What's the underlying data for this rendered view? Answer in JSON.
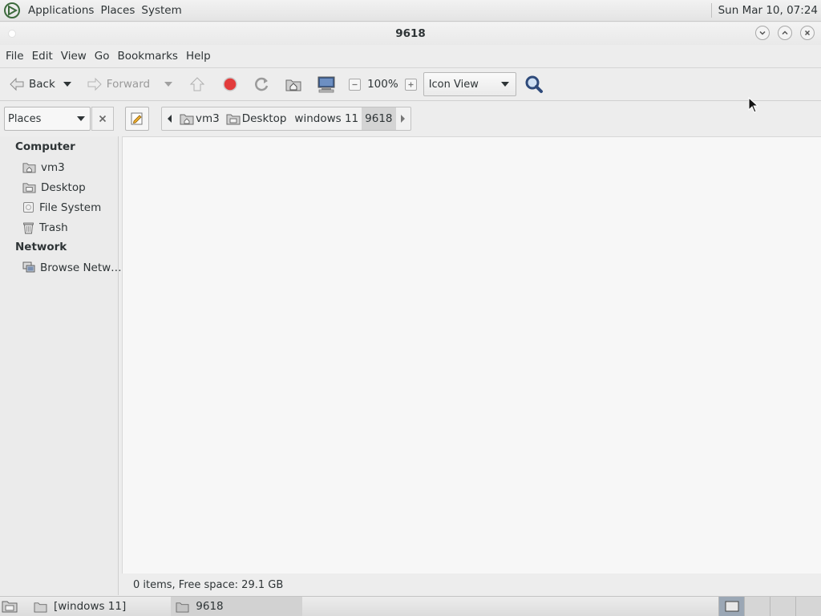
{
  "top_panel": {
    "menus": [
      "Applications",
      "Places",
      "System"
    ],
    "clock": "Sun Mar 10, 07:24"
  },
  "window": {
    "title": "9618"
  },
  "menubar": [
    "File",
    "Edit",
    "View",
    "Go",
    "Bookmarks",
    "Help"
  ],
  "toolbar": {
    "back_label": "Back",
    "forward_label": "Forward",
    "zoom_level": "100%",
    "view_mode": "Icon View"
  },
  "location": {
    "side_pane_mode": "Places",
    "breadcrumbs": [
      "vm3",
      "Desktop",
      "windows 11",
      "9618"
    ]
  },
  "sidebar": {
    "sections": [
      {
        "header": "Computer",
        "items": [
          "vm3",
          "Desktop",
          "File System",
          "Trash"
        ]
      },
      {
        "header": "Network",
        "items": [
          "Browse Netw…"
        ]
      }
    ]
  },
  "status": "0 items, Free space: 29.1 GB",
  "taskbar": {
    "tasks": [
      "[windows 11]",
      "9618"
    ]
  },
  "colors": {
    "accent_red": "#e23b3b",
    "folder": "#c9c9c9",
    "search_blue": "#2e4a7a"
  }
}
